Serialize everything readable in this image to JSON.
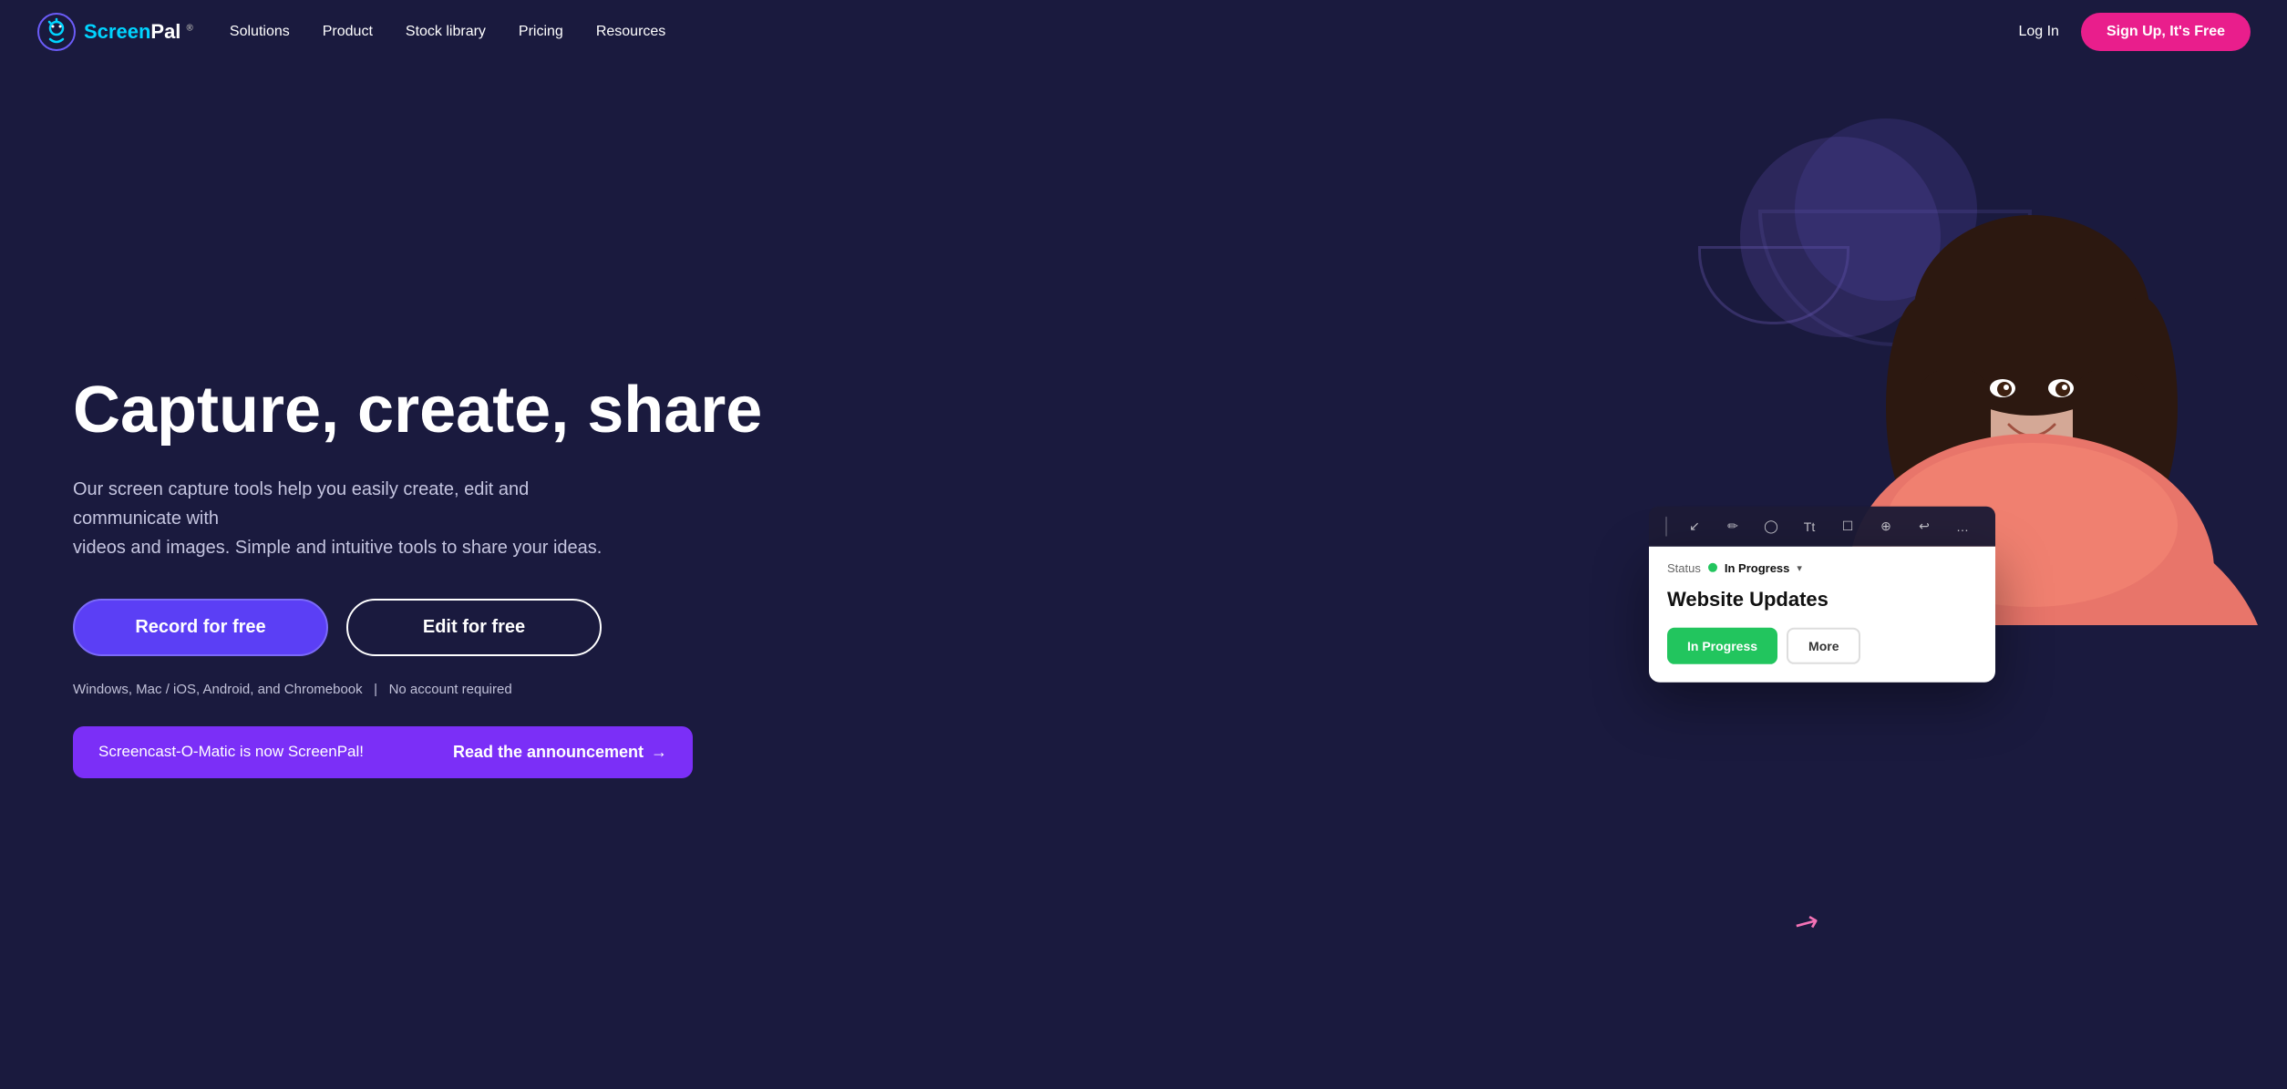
{
  "brand": {
    "name_part1": "Screen",
    "name_part2": "Pal",
    "logo_alt": "ScreenPal logo"
  },
  "nav": {
    "links": [
      {
        "id": "solutions",
        "label": "Solutions"
      },
      {
        "id": "product",
        "label": "Product"
      },
      {
        "id": "stock",
        "label": "Stock library"
      },
      {
        "id": "pricing",
        "label": "Pricing"
      },
      {
        "id": "resources",
        "label": "Resources"
      }
    ],
    "login_label": "Log In",
    "signup_label": "Sign Up, It's Free"
  },
  "hero": {
    "title": "Capture, create, share",
    "subtitle_line1": "Our screen capture tools help you easily create, edit and communicate with",
    "subtitle_line2": "videos and images. Simple and intuitive tools to share your ideas.",
    "btn_record": "Record for free",
    "btn_edit": "Edit for free",
    "footnote_platforms": "Windows, Mac / iOS, Android, and Chromebook",
    "footnote_separator": "|",
    "footnote_no_account": "No account required"
  },
  "announcement": {
    "text": "Screencast-O-Matic is now ScreenPal!",
    "link_label": "Read the announcement",
    "arrow": "→"
  },
  "mockup": {
    "toolbar_icons": [
      "||",
      "↙",
      "✏",
      "◯",
      "Tt",
      "☐",
      "⊕",
      "↩",
      "…"
    ],
    "status_label": "Status",
    "status_value": "In Progress",
    "card_title": "Website Updates",
    "btn_in_progress": "In Progress",
    "btn_more": "More"
  }
}
